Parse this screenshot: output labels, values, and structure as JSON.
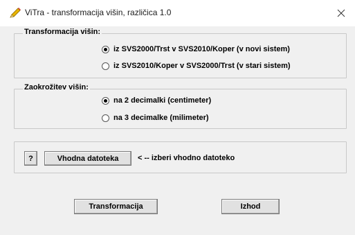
{
  "window": {
    "title": "ViTra - transformacija višin, različica 1.0"
  },
  "transformation_group": {
    "legend": "Transformacija višin:",
    "options": [
      {
        "label": "iz  SVS2000/Trst  v  SVS2010/Koper   (v novi sistem)",
        "checked": true
      },
      {
        "label": "iz  SVS2010/Koper  v  SVS2000/Trst   (v stari sistem)",
        "checked": false
      }
    ]
  },
  "rounding_group": {
    "legend": "Zaokrožitev višin:",
    "options": [
      {
        "label": "na 2 decimalki (centimeter)",
        "checked": true
      },
      {
        "label": "na 3 decimalke (milimeter)",
        "checked": false
      }
    ]
  },
  "input_file": {
    "help_label": "?",
    "button_label": "Vhodna datoteka",
    "hint": "< -- izberi vhodno datoteko"
  },
  "actions": {
    "transform_label": "Transformacija",
    "exit_label": "Izhod"
  }
}
